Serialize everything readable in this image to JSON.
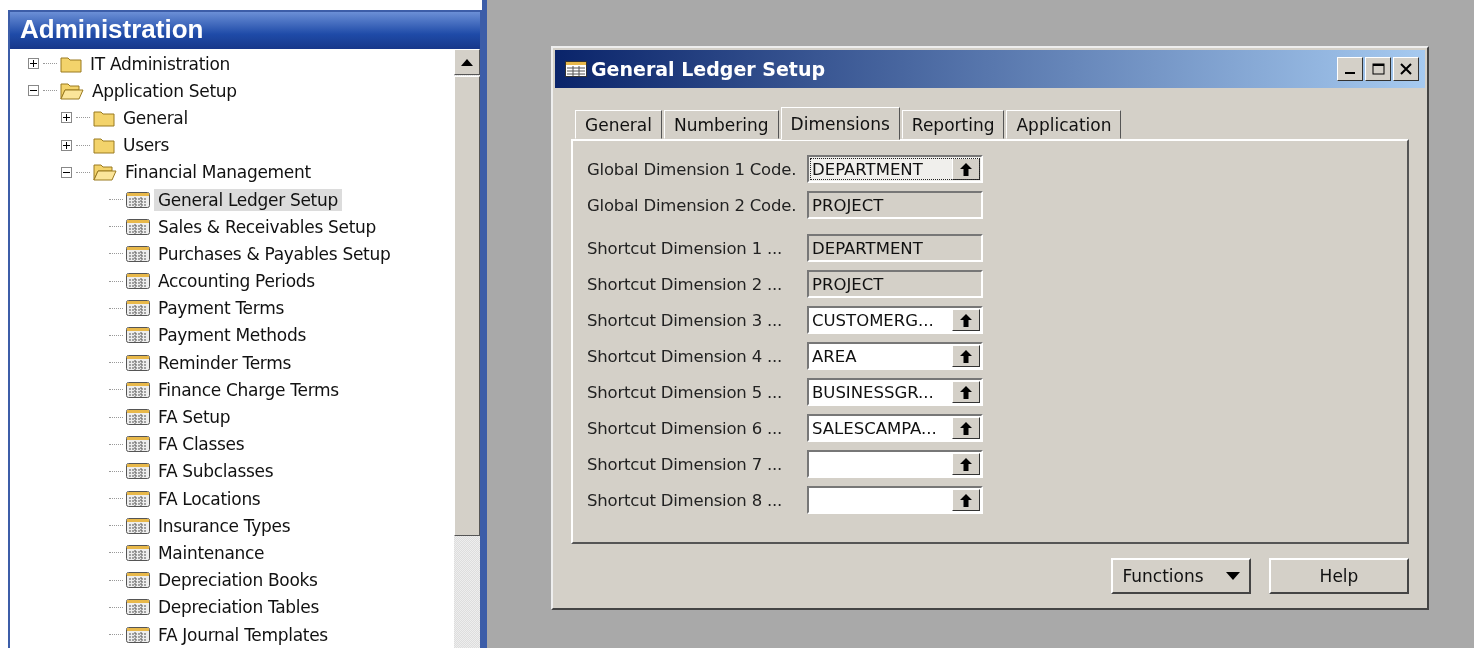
{
  "navigation_pane": {
    "title": "Administration",
    "tree": [
      {
        "label": "IT Administration",
        "kind": "folder",
        "expanded": false,
        "selected": false
      },
      {
        "label": "Application Setup",
        "kind": "folder",
        "expanded": true,
        "selected": false,
        "children": [
          {
            "label": "General",
            "kind": "folder",
            "expanded": false,
            "selected": false
          },
          {
            "label": "Users",
            "kind": "folder",
            "expanded": false,
            "selected": false
          },
          {
            "label": "Financial Management",
            "kind": "folder",
            "expanded": true,
            "selected": false,
            "children": [
              {
                "label": "General Ledger Setup",
                "kind": "form",
                "selected": true
              },
              {
                "label": "Sales & Receivables Setup",
                "kind": "form",
                "selected": false
              },
              {
                "label": "Purchases & Payables Setup",
                "kind": "form",
                "selected": false
              },
              {
                "label": "Accounting Periods",
                "kind": "form",
                "selected": false
              },
              {
                "label": "Payment Terms",
                "kind": "form",
                "selected": false
              },
              {
                "label": "Payment Methods",
                "kind": "form",
                "selected": false
              },
              {
                "label": "Reminder Terms",
                "kind": "form",
                "selected": false
              },
              {
                "label": "Finance Charge Terms",
                "kind": "form",
                "selected": false
              },
              {
                "label": "FA Setup",
                "kind": "form",
                "selected": false
              },
              {
                "label": "FA Classes",
                "kind": "form",
                "selected": false
              },
              {
                "label": "FA Subclasses",
                "kind": "form",
                "selected": false
              },
              {
                "label": "FA Locations",
                "kind": "form",
                "selected": false
              },
              {
                "label": "Insurance Types",
                "kind": "form",
                "selected": false
              },
              {
                "label": "Maintenance",
                "kind": "form",
                "selected": false
              },
              {
                "label": "Depreciation Books",
                "kind": "form",
                "selected": false
              },
              {
                "label": "Depreciation Tables",
                "kind": "form",
                "selected": false
              },
              {
                "label": "FA Journal Templates",
                "kind": "form",
                "selected": false
              }
            ]
          }
        ]
      }
    ]
  },
  "window": {
    "title": "General Ledger Setup",
    "tabs": [
      {
        "label": "General",
        "selected": false
      },
      {
        "label": "Numbering",
        "selected": false
      },
      {
        "label": "Dimensions",
        "selected": true
      },
      {
        "label": "Reporting",
        "selected": false
      },
      {
        "label": "Application",
        "selected": false
      }
    ],
    "global_dimensions": [
      {
        "label": "Global Dimension 1 Code.",
        "value": "DEPARTMENT",
        "editable": true,
        "focused": true
      },
      {
        "label": "Global Dimension 2 Code.",
        "value": "PROJECT",
        "editable": false,
        "focused": false
      }
    ],
    "shortcut_dimensions": [
      {
        "label": "Shortcut Dimension 1 ...",
        "value": "DEPARTMENT",
        "editable": false,
        "focused": false
      },
      {
        "label": "Shortcut Dimension 2 ...",
        "value": "PROJECT",
        "editable": false,
        "focused": false
      },
      {
        "label": "Shortcut Dimension 3 ...",
        "value": "CUSTOMERG...",
        "editable": true,
        "focused": false
      },
      {
        "label": "Shortcut Dimension 4 ...",
        "value": "AREA",
        "editable": true,
        "focused": false
      },
      {
        "label": "Shortcut Dimension 5 ...",
        "value": "BUSINESSGR...",
        "editable": true,
        "focused": false
      },
      {
        "label": "Shortcut Dimension 6 ...",
        "value": "SALESCAMPA...",
        "editable": true,
        "focused": false
      },
      {
        "label": "Shortcut Dimension 7 ...",
        "editable": true,
        "focused": false
      },
      {
        "label": "Shortcut Dimension 8 ...",
        "editable": true,
        "focused": false
      }
    ],
    "buttons": [
      {
        "label": "Functions",
        "kind": "menu"
      },
      {
        "label": "Help",
        "kind": "plain"
      }
    ]
  }
}
